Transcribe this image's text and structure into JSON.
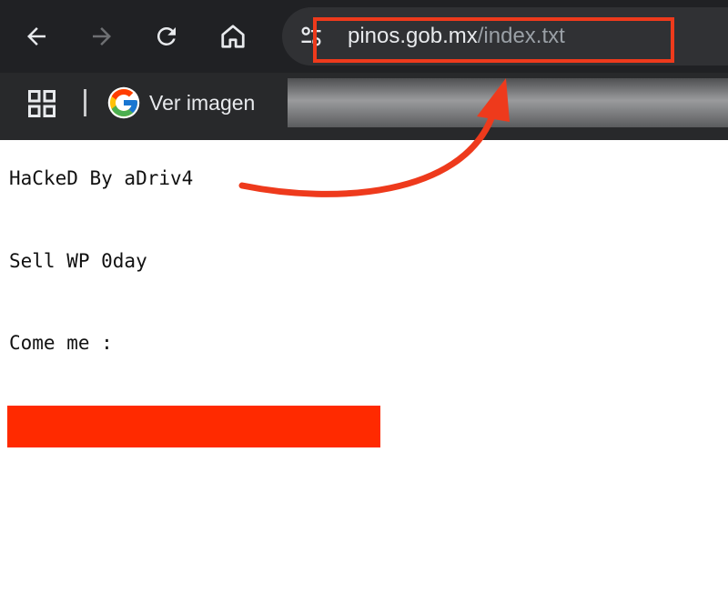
{
  "browser": {
    "nav": {
      "back_icon": "arrow-left-icon",
      "forward_icon": "arrow-right-icon",
      "reload_icon": "reload-icon",
      "home_icon": "home-icon"
    },
    "address_bar": {
      "site_info_icon": "tune-icon",
      "url_host": "pinos.gob.mx",
      "url_path": "/index.txt"
    },
    "bookmarks": {
      "apps_icon": "apps-grid-icon",
      "items": [
        {
          "label": "Ver imagen",
          "icon": "google-g-icon"
        }
      ]
    }
  },
  "page": {
    "lines": [
      "HaCkeD By aDriv4",
      "Sell WP 0day",
      "Come me :"
    ]
  },
  "annotations": {
    "highlight_color": "#ee3a1c",
    "arrow_color": "#ee3a1c",
    "redaction_color": "#ff2a00"
  }
}
